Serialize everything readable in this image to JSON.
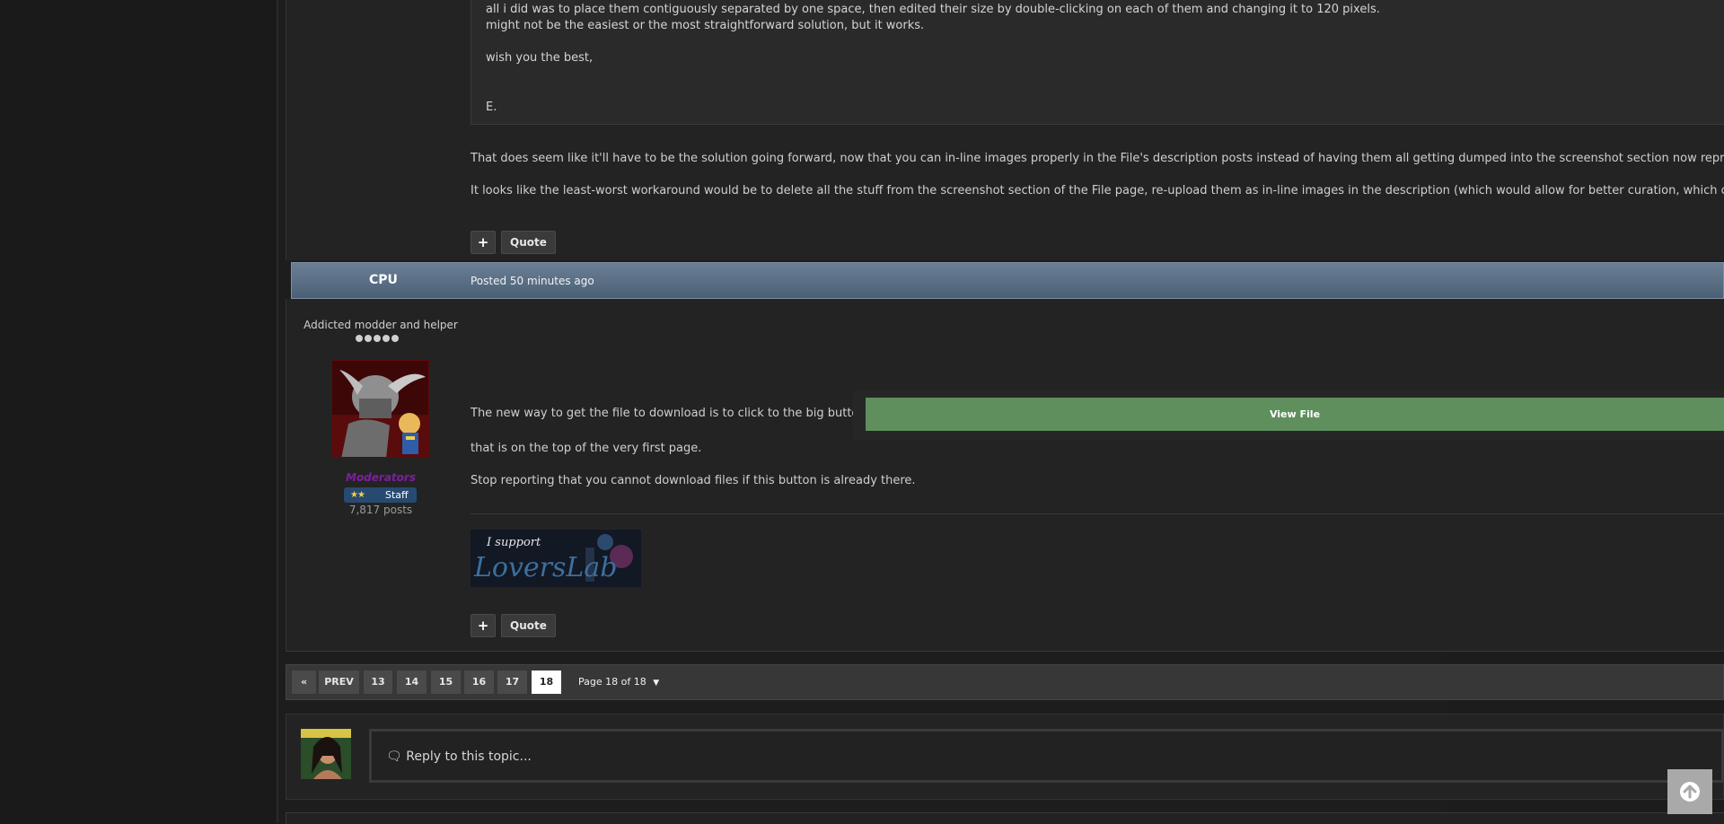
{
  "previous_post": {
    "quote_lines": [
      "all i did was to place them contiguously separated by one space, then edited their size by double-clicking on each of them and changing it to 120 pixels.",
      "might not be the easiest or the most straightforward solution, but it works.",
      "wish you the best,",
      "E."
    ],
    "paragraphs": [
      "That does seem like it'll have to be the solution going forward, now that you can in-line images properly in the File's description posts instead of having them all getting dumped into the screenshot section now represented by",
      "It looks like the least-worst workaround would be to delete all the stuff from the screenshot section of the File page, re-upload them as in-line images in the description (which would allow for better curation, which certainly isn"
    ],
    "plus_label": "+",
    "quote_label": "Quote"
  },
  "post": {
    "author": "CPU",
    "posted": "Posted 50 minutes ago",
    "author_title": "Addicted modder and helper",
    "group": "Moderators",
    "badge_stars": "★★",
    "badge_label": "Staff",
    "post_count": "7,817 posts",
    "text_before_button": "The new way to get the file to download is to click to the big button",
    "view_file_label": "View File",
    "text_after_1": "that is on the top of the very first page.",
    "text_after_2": "Stop reporting that you cannot download files if this button is already there.",
    "signature_line1": "I support",
    "signature_line2": "LoversLab",
    "plus_label": "+",
    "quote_label": "Quote"
  },
  "pagination": {
    "first": "«",
    "prev": "PREV",
    "pages": [
      "13",
      "14",
      "15",
      "16",
      "17",
      "18"
    ],
    "current": "18",
    "page_of": "Page 18 of 18"
  },
  "reply": {
    "placeholder": "Reply to this topic..."
  },
  "colors": {
    "header_bar": "#5a6e83",
    "view_file_green": "#5e8f5c",
    "moderator_purple": "#7c1fa0",
    "staff_badge": "#274a71"
  }
}
